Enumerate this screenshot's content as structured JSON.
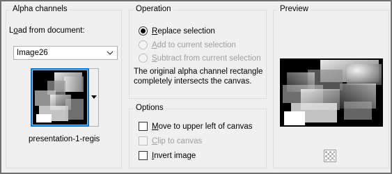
{
  "alpha_channels": {
    "title": "Alpha channels",
    "load_label_pre": "L",
    "load_label_underlined": "o",
    "load_label_post": "ad from document:",
    "document_value": "Image26",
    "channel_name": "presentation-1-regis"
  },
  "operation": {
    "title": "Operation",
    "replace": {
      "pre": "",
      "u": "R",
      "post": "eplace selection",
      "checked": true,
      "enabled": true
    },
    "add": {
      "pre": "",
      "u": "A",
      "post": "dd to current selection",
      "checked": false,
      "enabled": false
    },
    "subtract": {
      "pre": "",
      "u": "S",
      "post": "ubtract from current selection",
      "checked": false,
      "enabled": false
    },
    "description": "The original alpha channel rectangle completely intersects the canvas."
  },
  "options": {
    "title": "Options",
    "move_upper_left": {
      "pre": "",
      "u": "M",
      "post": "ove to upper left of canvas",
      "checked": false,
      "enabled": true
    },
    "clip_canvas": {
      "pre": "",
      "u": "C",
      "post": "lip to canvas",
      "checked": false,
      "enabled": false
    },
    "invert_image": {
      "pre": "",
      "u": "I",
      "post": "nvert image",
      "checked": false,
      "enabled": true
    }
  },
  "preview": {
    "title": "Preview"
  },
  "colors": {
    "dialog_bg": "#f0f0f0",
    "selection_blue": "#0078d7",
    "disabled_text": "#9e9e9e"
  }
}
